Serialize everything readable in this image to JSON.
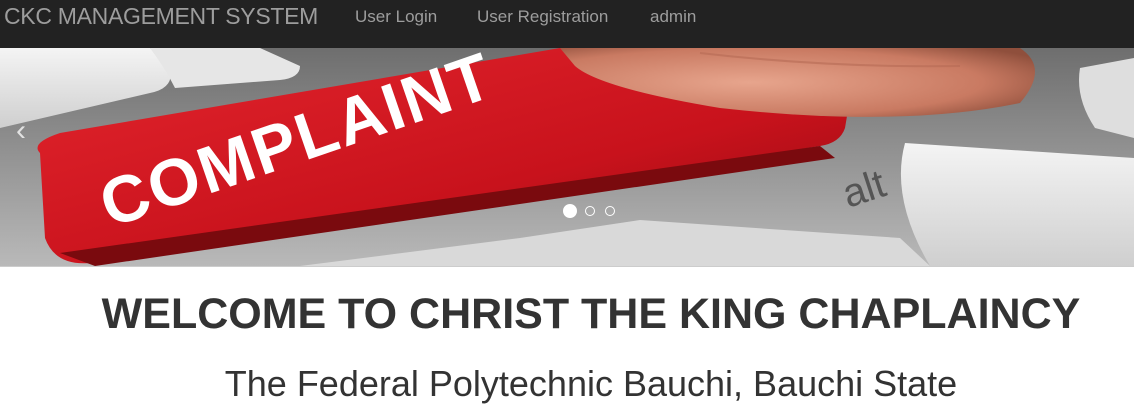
{
  "navbar": {
    "brand": "CKC MANAGEMENT SYSTEM",
    "links": [
      {
        "label": "User Login"
      },
      {
        "label": "User Registration"
      },
      {
        "label": "admin"
      }
    ]
  },
  "carousel": {
    "slide_text": "COMPLAINT",
    "key_text": "alt",
    "prev_glyph": "‹",
    "indicators": 3,
    "active_indicator": 1,
    "icons": {
      "prev": "chevron-left-icon"
    }
  },
  "main": {
    "heading": "WELCOME TO CHRIST THE KING CHAPLAINCY",
    "subheading": "The Federal Polytechnic Bauchi, Bauchi State"
  },
  "colors": {
    "navbar_bg": "#222222",
    "nav_text": "#9d9d9d",
    "key_red": "#c8121c",
    "heading_text": "#333333"
  }
}
